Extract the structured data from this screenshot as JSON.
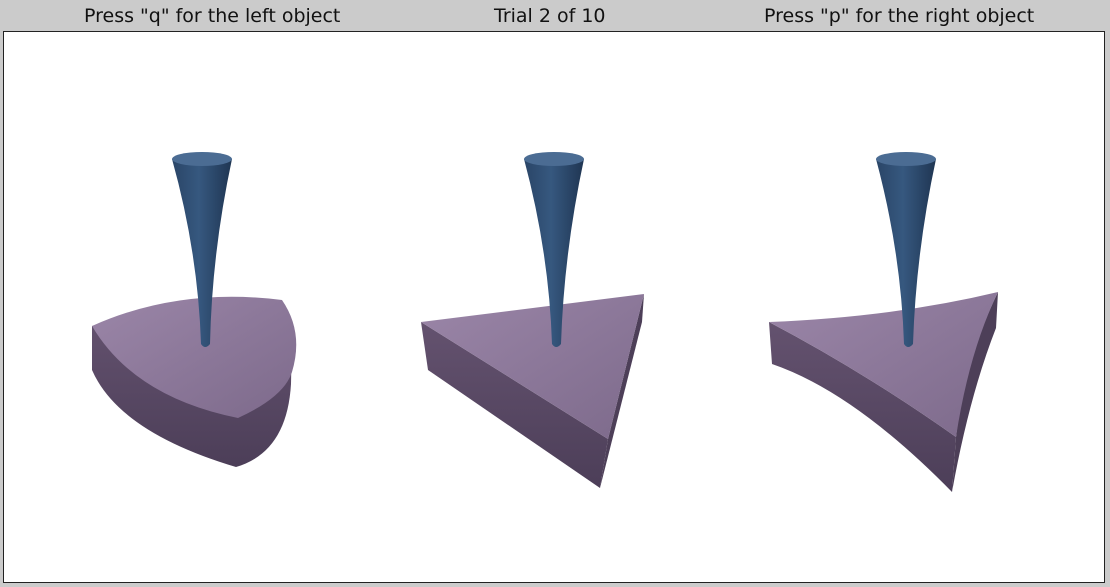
{
  "header": {
    "left_label": "Press \"q\" for the left object",
    "center_label": "Trial 2 of 10",
    "right_label": "Press \"p\" for the right object"
  },
  "stimuli": {
    "left_object": {
      "base_shape": "reuleaux-triangle-icon"
    },
    "center_object": {
      "base_shape": "triangle-icon"
    },
    "right_object": {
      "base_shape": "concave-triangle-icon"
    }
  },
  "colors": {
    "background": "#cbcbcb",
    "stage": "#ffffff",
    "stem": "#2f4f74",
    "stem_top": "#4b6c93",
    "base_top": "#8c7898",
    "base_side": "#5b4a67"
  }
}
